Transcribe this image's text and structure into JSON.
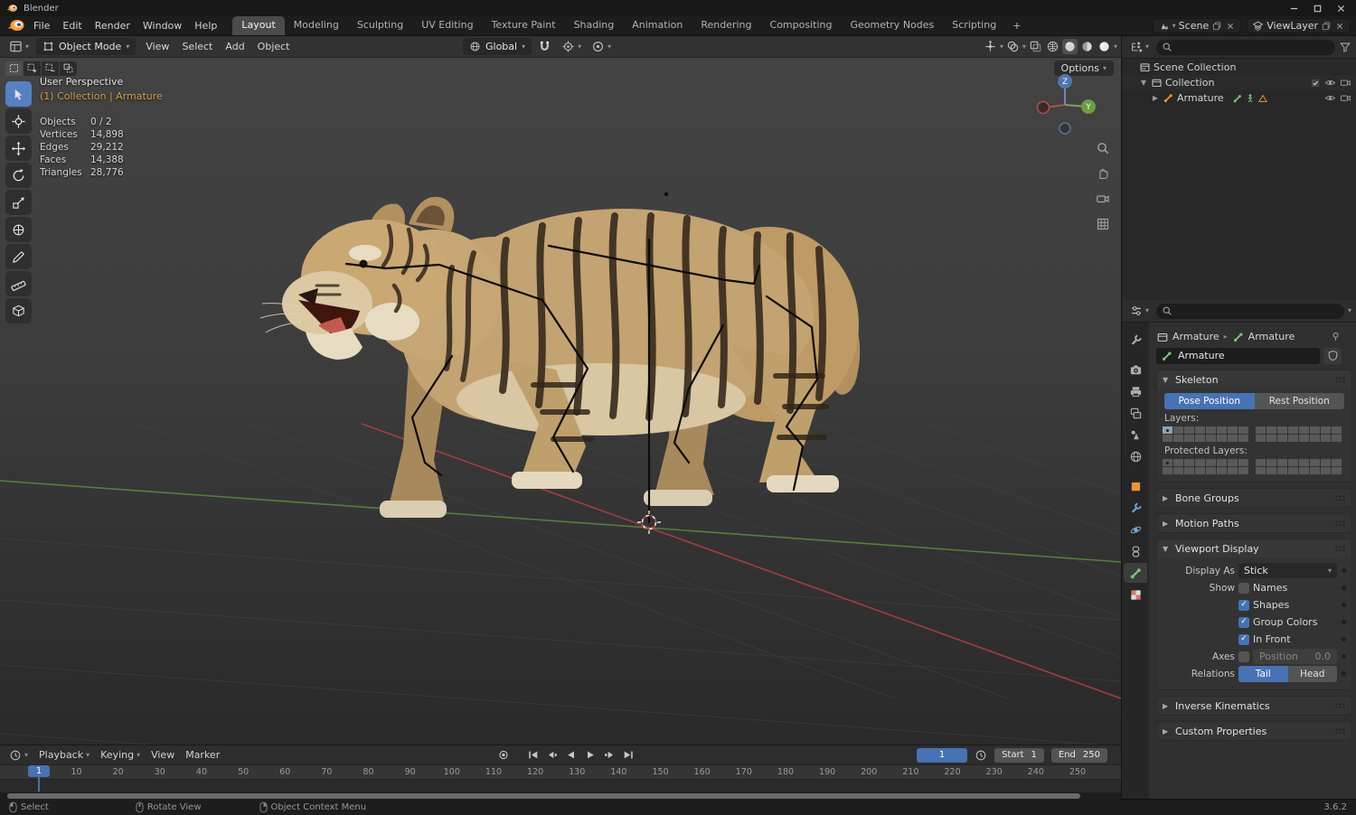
{
  "window": {
    "title": "Blender",
    "version": "3.6.2"
  },
  "colors": {
    "accent": "#4772b3",
    "object_orange": "#e8933a",
    "data_green": "#7cc47c",
    "context_label": "#d0a04c",
    "axis_red": "#b work33e3e"
  },
  "topbar": {
    "menus": [
      "File",
      "Edit",
      "Render",
      "Window",
      "Help"
    ],
    "tabs": [
      "Layout",
      "Modeling",
      "Sculpting",
      "UV Editing",
      "Texture Paint",
      "Shading",
      "Animation",
      "Rendering",
      "Compositing",
      "Geometry Nodes",
      "Scripting"
    ],
    "active_tab": "Layout",
    "add_tab": "+",
    "scene_label": "Scene",
    "viewlayer_label": "ViewLayer"
  },
  "viewport_header": {
    "mode": "Object Mode",
    "menus": [
      "View",
      "Select",
      "Add",
      "Object"
    ],
    "orientation": "Global",
    "options_label": "Options"
  },
  "viewport": {
    "perspective": "User Perspective",
    "context": "(1) Collection | Armature",
    "stats": [
      {
        "label": "Objects",
        "value": "0 / 2"
      },
      {
        "label": "Vertices",
        "value": "14,898"
      },
      {
        "label": "Edges",
        "value": "29,212"
      },
      {
        "label": "Faces",
        "value": "14,388"
      },
      {
        "label": "Triangles",
        "value": "28,776"
      }
    ],
    "gizmo": {
      "z": "Z",
      "y": "Y"
    },
    "tools": [
      "select-box",
      "cursor",
      "move",
      "rotate",
      "scale",
      "transform",
      "annotate",
      "measure",
      "add-cube"
    ],
    "select_modes": [
      "new",
      "extend",
      "subtract",
      "invert"
    ]
  },
  "outliner": {
    "rows": [
      {
        "label": "Scene Collection",
        "icon": "scene-collection",
        "depth": 0,
        "caret": "",
        "extras": [],
        "controls": []
      },
      {
        "label": "Collection",
        "icon": "collection",
        "depth": 1,
        "caret": "down",
        "extras": [],
        "controls": [
          "check",
          "eye",
          "camera"
        ]
      },
      {
        "label": "Armature",
        "icon": "armature-object",
        "depth": 2,
        "caret": "right",
        "extras": [
          "armature-data",
          "pose",
          "child-mesh"
        ],
        "controls": [
          "eye",
          "camera"
        ]
      }
    ]
  },
  "properties": {
    "tabs": [
      "tool",
      "render",
      "output",
      "view-layer",
      "scene",
      "world",
      "object",
      "modifiers",
      "physics",
      "constraints",
      "object-data",
      "texture"
    ],
    "active_tab": "object-data",
    "breadcrumb": {
      "object": "Armature",
      "data": "Armature"
    },
    "name_value": "Armature",
    "skeleton": {
      "title": "Skeleton",
      "pose_position": "Pose Position",
      "rest_position": "Rest Position",
      "active": "Pose Position",
      "layers_label": "Layers:",
      "protected_layers_label": "Protected Layers:",
      "layers": {
        "selected": [
          0
        ],
        "dot": [
          0
        ]
      },
      "protected_layers": {
        "selected": [],
        "dot": [
          0
        ]
      }
    },
    "collapsed_top": [
      "Bone Groups",
      "Motion Paths"
    ],
    "viewport_display": {
      "title": "Viewport Display",
      "display_as_label": "Display As",
      "display_as": "Stick",
      "show_label": "Show",
      "options": [
        {
          "label": "Names",
          "checked": false
        },
        {
          "label": "Shapes",
          "checked": true
        },
        {
          "label": "Group Colors",
          "checked": true
        },
        {
          "label": "In Front",
          "checked": true
        }
      ],
      "axes_label": "Axes",
      "position_label": "Position",
      "position_value": "0.0",
      "relations_label": "Relations",
      "tail": "Tail",
      "head": "Head",
      "relations_active": "Tail"
    },
    "collapsed_bottom": [
      "Inverse Kinematics",
      "Custom Properties"
    ]
  },
  "timeline": {
    "menus": [
      {
        "label": "Playback",
        "caret": true
      },
      {
        "label": "Keying",
        "caret": true
      },
      {
        "label": "View",
        "caret": false
      },
      {
        "label": "Marker",
        "caret": false
      }
    ],
    "current_frame": "1",
    "start_label": "Start",
    "start_value": "1",
    "end_label": "End",
    "end_value": "250",
    "tick_frames": [
      10,
      20,
      30,
      40,
      50,
      60,
      70,
      80,
      90,
      100,
      110,
      120,
      130,
      140,
      150,
      160,
      170,
      180,
      190,
      200,
      210,
      220,
      230,
      240,
      250
    ]
  },
  "statusbar": {
    "items": [
      {
        "label": "Select",
        "icon": "mouse-left"
      },
      {
        "label": "Rotate View",
        "icon": "mouse-middle"
      },
      {
        "label": "Object Context Menu",
        "icon": "mouse-right"
      }
    ],
    "version": "3.6.2"
  }
}
